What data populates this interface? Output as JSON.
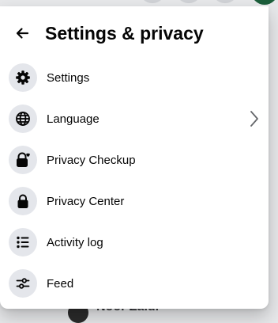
{
  "panel": {
    "title": "Settings & privacy",
    "back_icon": "arrow-left-icon"
  },
  "items": [
    {
      "label": "Settings",
      "icon": "gear-icon"
    },
    {
      "label": "Language",
      "icon": "globe-icon",
      "has_chevron": true
    },
    {
      "label": "Privacy Checkup",
      "icon": "lock-heart-icon"
    },
    {
      "label": "Privacy Center",
      "icon": "lock-icon"
    },
    {
      "label": "Activity log",
      "icon": "list-icon"
    },
    {
      "label": "Feed",
      "icon": "sliders-icon"
    }
  ],
  "background": {
    "footer_text": "Noor Zaidi"
  },
  "colors": {
    "text": "#050505",
    "icon_circle": "#e4e6eb",
    "panel": "#ffffff"
  }
}
